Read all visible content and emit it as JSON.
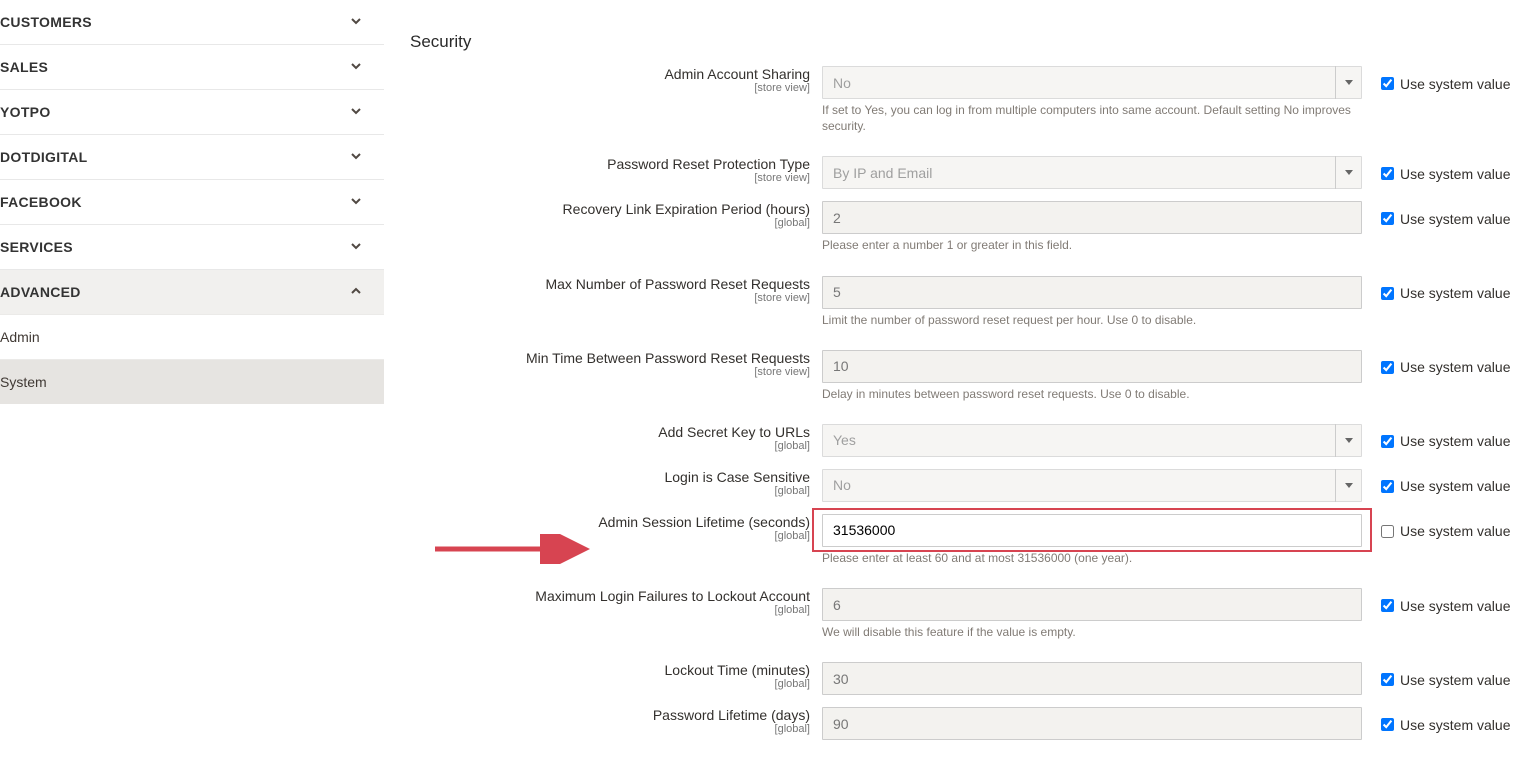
{
  "sidebar": {
    "items": [
      {
        "label": "CUSTOMERS",
        "expanded": false
      },
      {
        "label": "SALES",
        "expanded": false
      },
      {
        "label": "YOTPO",
        "expanded": false
      },
      {
        "label": "DOTDIGITAL",
        "expanded": false
      },
      {
        "label": "FACEBOOK",
        "expanded": false
      },
      {
        "label": "SERVICES",
        "expanded": false
      },
      {
        "label": "ADVANCED",
        "expanded": true
      }
    ],
    "subitems": [
      {
        "label": "Admin",
        "active": false
      },
      {
        "label": "System",
        "active": true
      }
    ]
  },
  "section": {
    "title": "Security"
  },
  "fields": [
    {
      "id": "account_sharing",
      "label": "Admin Account Sharing",
      "scope": "[store view]",
      "type": "select",
      "value": "No",
      "hint": "If set to Yes, you can log in from multiple computers into same account. Default setting No improves security.",
      "use_system": true
    },
    {
      "id": "pw_reset_protection",
      "label": "Password Reset Protection Type",
      "scope": "[store view]",
      "type": "select",
      "value": "By IP and Email",
      "hint": "",
      "use_system": true
    },
    {
      "id": "recovery_link_exp",
      "label": "Recovery Link Expiration Period (hours)",
      "scope": "[global]",
      "type": "text",
      "value": "2",
      "hint": "Please enter a number 1 or greater in this field.",
      "use_system": true
    },
    {
      "id": "max_pw_reset",
      "label": "Max Number of Password Reset Requests",
      "scope": "[store view]",
      "type": "text",
      "value": "5",
      "hint": "Limit the number of password reset request per hour. Use 0 to disable.",
      "use_system": true
    },
    {
      "id": "min_time_pw_reset",
      "label": "Min Time Between Password Reset Requests",
      "scope": "[store view]",
      "type": "text",
      "value": "10",
      "hint": "Delay in minutes between password reset requests. Use 0 to disable.",
      "use_system": true
    },
    {
      "id": "secret_key_urls",
      "label": "Add Secret Key to URLs",
      "scope": "[global]",
      "type": "select",
      "value": "Yes",
      "hint": "",
      "use_system": true
    },
    {
      "id": "login_case_sensitive",
      "label": "Login is Case Sensitive",
      "scope": "[global]",
      "type": "select",
      "value": "No",
      "hint": "",
      "use_system": true
    },
    {
      "id": "session_lifetime",
      "label": "Admin Session Lifetime (seconds)",
      "scope": "[global]",
      "type": "text",
      "value": "31536000",
      "hint": "Please enter at least 60 and at most 31536000 (one year).",
      "use_system": false,
      "highlight": true
    },
    {
      "id": "max_login_failures",
      "label": "Maximum Login Failures to Lockout Account",
      "scope": "[global]",
      "type": "text",
      "value": "6",
      "hint": "We will disable this feature if the value is empty.",
      "use_system": true
    },
    {
      "id": "lockout_time",
      "label": "Lockout Time (minutes)",
      "scope": "[global]",
      "type": "text",
      "value": "30",
      "hint": "",
      "use_system": true
    },
    {
      "id": "password_lifetime",
      "label": "Password Lifetime (days)",
      "scope": "[global]",
      "type": "text",
      "value": "90",
      "hint": "",
      "use_system": true
    }
  ],
  "use_system_label": "Use system value",
  "colors": {
    "highlight": "#d74451",
    "arrow": "#d74451"
  }
}
